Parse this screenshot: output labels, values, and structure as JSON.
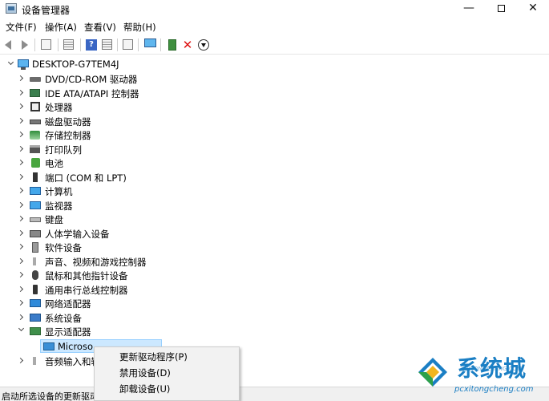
{
  "window": {
    "title": "设备管理器",
    "minimize": "—",
    "close": "✕"
  },
  "menu": [
    "文件(F)",
    "操作(A)",
    "查看(V)",
    "帮助(H)"
  ],
  "tree": {
    "root": "DESKTOP-G7TEM4J",
    "categories": [
      {
        "label": "DVD/CD-ROM 驱动器",
        "icon": "dvd-drive-icon"
      },
      {
        "label": "IDE ATA/ATAPI 控制器",
        "icon": "ide-controller-icon"
      },
      {
        "label": "处理器",
        "icon": "processor-icon"
      },
      {
        "label": "磁盘驱动器",
        "icon": "disk-drive-icon"
      },
      {
        "label": "存储控制器",
        "icon": "storage-controller-icon"
      },
      {
        "label": "打印队列",
        "icon": "print-queue-icon"
      },
      {
        "label": "电池",
        "icon": "battery-icon"
      },
      {
        "label": "端口 (COM 和 LPT)",
        "icon": "port-icon"
      },
      {
        "label": "计算机",
        "icon": "computer-icon"
      },
      {
        "label": "监视器",
        "icon": "monitor-icon"
      },
      {
        "label": "键盘",
        "icon": "keyboard-icon"
      },
      {
        "label": "人体学输入设备",
        "icon": "hid-icon"
      },
      {
        "label": "软件设备",
        "icon": "software-device-icon"
      },
      {
        "label": "声音、视频和游戏控制器",
        "icon": "sound-icon"
      },
      {
        "label": "鼠标和其他指针设备",
        "icon": "mouse-icon"
      },
      {
        "label": "通用串行总线控制器",
        "icon": "usb-icon"
      },
      {
        "label": "网络适配器",
        "icon": "network-adapter-icon"
      },
      {
        "label": "系统设备",
        "icon": "system-device-icon"
      },
      {
        "label": "显示适配器",
        "icon": "display-adapter-icon"
      }
    ],
    "child_device": "Microso",
    "last_partial": "音频输入和输"
  },
  "context_menu": {
    "items": [
      "更新驱动程序(P)",
      "禁用设备(D)",
      "卸载设备(U)"
    ]
  },
  "status": "启动所选设备的更新驱动",
  "watermark": {
    "name": "系统城",
    "site": "pcxitongcheng.com",
    "faint": "XITONGCHENG.COM"
  },
  "colors": {
    "selection": "#cce8ff",
    "watermark": "#1b7fc4"
  }
}
